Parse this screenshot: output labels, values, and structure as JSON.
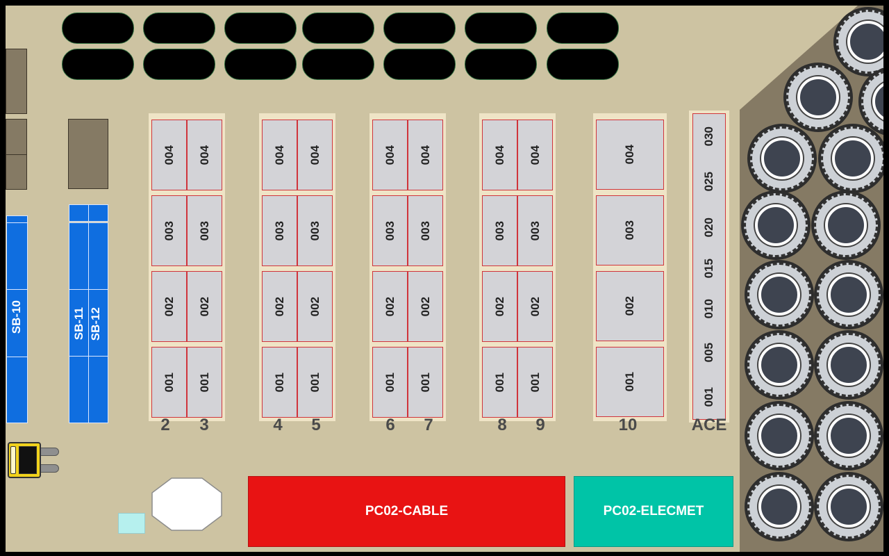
{
  "map": {
    "sb_racks": [
      {
        "id": "sb10",
        "label": "SB-10"
      },
      {
        "id": "sb11",
        "label": "SB-11"
      },
      {
        "id": "sb12",
        "label": "SB-12"
      }
    ],
    "rack_pairs": [
      {
        "left_label": "2",
        "right_label": "3",
        "levels": [
          "004",
          "003",
          "002",
          "001"
        ]
      },
      {
        "left_label": "4",
        "right_label": "5",
        "levels": [
          "004",
          "003",
          "002",
          "001"
        ]
      },
      {
        "left_label": "6",
        "right_label": "7",
        "levels": [
          "004",
          "003",
          "002",
          "001"
        ]
      },
      {
        "left_label": "8",
        "right_label": "9",
        "levels": [
          "004",
          "003",
          "002",
          "001"
        ]
      }
    ],
    "rack_10": {
      "label": "10",
      "levels": [
        "004",
        "003",
        "002",
        "001"
      ]
    },
    "rack_ace": {
      "label": "ACE",
      "levels": [
        "030",
        "025",
        "020",
        "015",
        "010",
        "005",
        "001"
      ]
    },
    "zones": {
      "cable": {
        "label": "PC02-CABLE",
        "color": "#e81313"
      },
      "elecmet": {
        "label": "PC02-ELECMET",
        "color": "#00c4a7"
      }
    },
    "colors": {
      "floor": "#cdc3a2",
      "reel_area": "#857a64",
      "sb_blue": "#0f6ee0",
      "bin_border": "#d0343b"
    },
    "icons": {
      "forklift": "forklift-icon",
      "reel": "cable-reel-icon",
      "column": "octagon-column-icon"
    }
  }
}
